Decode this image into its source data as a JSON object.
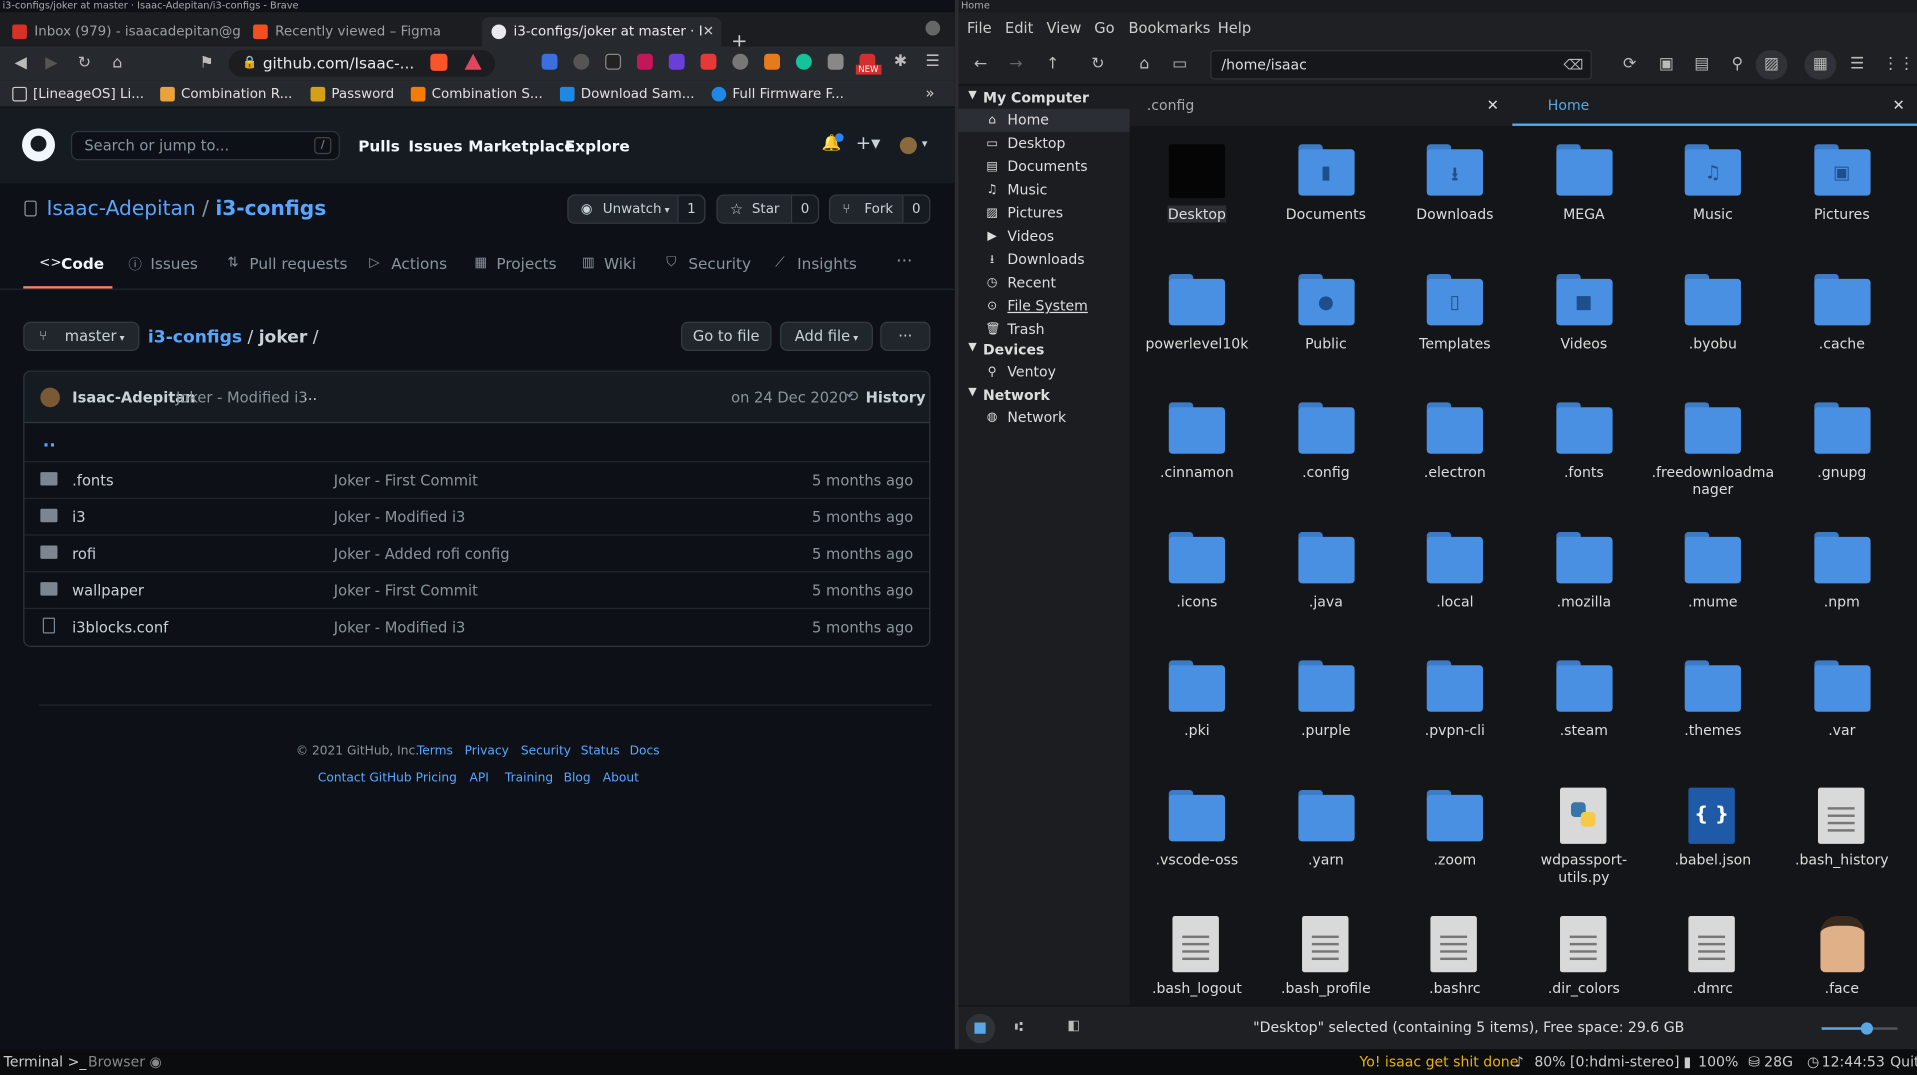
{
  "browser": {
    "title": "i3-configs/joker at master · Isaac-Adepitan/i3-configs - Brave",
    "tabs": [
      {
        "label": "Inbox (979) - isaacadepitan@g",
        "color": "#d93025"
      },
      {
        "label": "Recently viewed – Figma",
        "color": "#f24e1e"
      },
      {
        "label": "i3-configs/joker at master · I",
        "color": "#e8eaed"
      }
    ],
    "url": "github.com/Isaac-...",
    "badge_new": "NEW",
    "bookmarks": [
      {
        "label": "[LineageOS] Li...",
        "color": "#cccccc"
      },
      {
        "label": "Combination R...",
        "color": "#e8a33d"
      },
      {
        "label": "Password",
        "color": "#d4a017"
      },
      {
        "label": "Combination S...",
        "color": "#f57c00"
      },
      {
        "label": "Download Sam...",
        "color": "#1e88e5"
      },
      {
        "label": "Full Firmware F...",
        "color": "#1e88e5"
      }
    ]
  },
  "github": {
    "search_placeholder": "Search or jump to...",
    "search_key": "/",
    "nav": [
      "Pulls",
      "Issues",
      "Marketplace",
      "Explore"
    ],
    "owner": "Isaac-Adepitan",
    "sep": "/",
    "repo": "i3-configs",
    "watch": {
      "label": "Unwatch",
      "count": "1"
    },
    "star": {
      "label": "Star",
      "count": "0"
    },
    "fork": {
      "label": "Fork",
      "count": "0"
    },
    "tabs": [
      "Code",
      "Issues",
      "Pull requests",
      "Actions",
      "Projects",
      "Wiki",
      "Security",
      "Insights"
    ],
    "more": "···",
    "branch": "master",
    "crumb_repo": "i3-configs",
    "crumb_dir": "joker",
    "go_to_file": "Go to file",
    "add_file": "Add file",
    "commit": {
      "author": "Isaac-Adepitan",
      "message": "Joker - Modified i3",
      "dots": "...",
      "date": "on 24 Dec 2020",
      "history": "History"
    },
    "parent": "..",
    "files": [
      {
        "name": ".fonts",
        "message": "Joker - First Commit",
        "age": "5 months ago",
        "type": "dir"
      },
      {
        "name": "i3",
        "message": "Joker - Modified i3",
        "age": "5 months ago",
        "type": "dir"
      },
      {
        "name": "rofi",
        "message": "Joker - Added rofi config",
        "age": "5 months ago",
        "type": "dir"
      },
      {
        "name": "wallpaper",
        "message": "Joker - First Commit",
        "age": "5 months ago",
        "type": "dir"
      },
      {
        "name": "i3blocks.conf",
        "message": "Joker - Modified i3",
        "age": "5 months ago",
        "type": "file"
      }
    ],
    "footer": {
      "copyright": "© 2021 GitHub, Inc.",
      "row1": [
        "Terms",
        "Privacy",
        "Security",
        "Status",
        "Docs"
      ],
      "row2": [
        "Contact GitHub",
        "Pricing",
        "API",
        "Training",
        "Blog",
        "About"
      ]
    }
  },
  "filemanager": {
    "title": "Home",
    "menu": [
      "File",
      "Edit",
      "View",
      "Go",
      "Bookmarks",
      "Help"
    ],
    "path": "/home/isaac",
    "sidebar": {
      "my_computer": "My Computer",
      "items": [
        "Home",
        "Desktop",
        "Documents",
        "Music",
        "Pictures",
        "Videos",
        "Downloads",
        "Recent",
        "File System",
        "Trash"
      ],
      "devices": "Devices",
      "device_items": [
        "Ventoy"
      ],
      "network": "Network",
      "network_items": [
        "Network"
      ]
    },
    "tabs": [
      ".config",
      "Home"
    ],
    "items": [
      {
        "name": "Desktop",
        "kind": "desktop"
      },
      {
        "name": "Documents",
        "kind": "folder",
        "emblem": "▮"
      },
      {
        "name": "Downloads",
        "kind": "folder",
        "emblem": "⭳"
      },
      {
        "name": "MEGA",
        "kind": "folder",
        "emblem": ""
      },
      {
        "name": "Music",
        "kind": "folder",
        "emblem": "♫"
      },
      {
        "name": "Pictures",
        "kind": "folder",
        "emblem": "▣"
      },
      {
        "name": "powerlevel10k",
        "kind": "folder",
        "emblem": ""
      },
      {
        "name": "Public",
        "kind": "folder",
        "emblem": "●"
      },
      {
        "name": "Templates",
        "kind": "folder",
        "emblem": "▯"
      },
      {
        "name": "Videos",
        "kind": "folder",
        "emblem": "■"
      },
      {
        "name": ".byobu",
        "kind": "folder",
        "emblem": ""
      },
      {
        "name": ".cache",
        "kind": "folder",
        "emblem": ""
      },
      {
        "name": ".cinnamon",
        "kind": "folder",
        "emblem": ""
      },
      {
        "name": ".config",
        "kind": "folder",
        "emblem": ""
      },
      {
        "name": ".electron",
        "kind": "folder",
        "emblem": ""
      },
      {
        "name": ".fonts",
        "kind": "folder",
        "emblem": ""
      },
      {
        "name": ".freedownloadmanager",
        "kind": "folder",
        "emblem": ""
      },
      {
        "name": ".gnupg",
        "kind": "folder",
        "emblem": ""
      },
      {
        "name": ".icons",
        "kind": "folder",
        "emblem": ""
      },
      {
        "name": ".java",
        "kind": "folder",
        "emblem": ""
      },
      {
        "name": ".local",
        "kind": "folder",
        "emblem": ""
      },
      {
        "name": ".mozilla",
        "kind": "folder",
        "emblem": ""
      },
      {
        "name": ".mume",
        "kind": "folder",
        "emblem": ""
      },
      {
        "name": ".npm",
        "kind": "folder",
        "emblem": ""
      },
      {
        "name": ".pki",
        "kind": "folder",
        "emblem": ""
      },
      {
        "name": ".purple",
        "kind": "folder",
        "emblem": ""
      },
      {
        "name": ".pvpn-cli",
        "kind": "folder",
        "emblem": ""
      },
      {
        "name": ".steam",
        "kind": "folder",
        "emblem": ""
      },
      {
        "name": ".themes",
        "kind": "folder",
        "emblem": ""
      },
      {
        "name": ".var",
        "kind": "folder",
        "emblem": ""
      },
      {
        "name": ".vscode-oss",
        "kind": "folder",
        "emblem": ""
      },
      {
        "name": ".yarn",
        "kind": "folder",
        "emblem": ""
      },
      {
        "name": ".zoom",
        "kind": "folder",
        "emblem": ""
      },
      {
        "name": "wdpassport-utils.py",
        "kind": "python"
      },
      {
        "name": ".babel.json",
        "kind": "json"
      },
      {
        "name": ".bash_history",
        "kind": "doc"
      },
      {
        "name": ".bash_logout",
        "kind": "doc"
      },
      {
        "name": ".bash_profile",
        "kind": "doc"
      },
      {
        "name": ".bashrc",
        "kind": "doc"
      },
      {
        "name": ".dir_colors",
        "kind": "doc"
      },
      {
        "name": ".dmrc",
        "kind": "doc"
      },
      {
        "name": ".face",
        "kind": "face"
      }
    ],
    "status": "\"Desktop\" selected (containing 5 items), Free space: 29.6 GB",
    "zoom_level": 0.6
  },
  "taskbar": {
    "terminal": "Terminal",
    "browser": "Browser",
    "message": "Yo! isaac get shit done",
    "audio": "80% [0:hdmi-stereo]",
    "battery": "100%",
    "disk": "28G",
    "time": "12:44:53",
    "quit": "Quit"
  }
}
